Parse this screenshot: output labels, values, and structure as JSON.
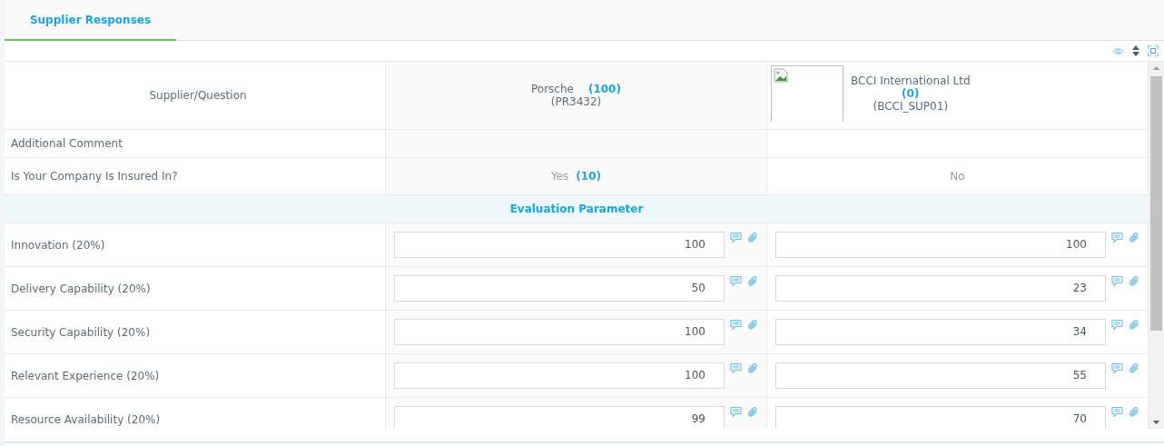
{
  "tabs": [
    {
      "label": "Supplier Responses",
      "selected": true
    }
  ],
  "table": {
    "header_label": "Supplier/Question",
    "suppliers": [
      {
        "name": "Porsche",
        "score": "(100)",
        "code": "(PR3432)",
        "has_logo": false
      },
      {
        "name": "BCCI International Ltd",
        "score": "(0)",
        "code": "(BCCI_SUP01)",
        "has_logo": true
      }
    ],
    "rows": [
      {
        "kind": "question",
        "label": "Additional Comment"
      },
      {
        "kind": "question",
        "label": "Is Your Company Is Insured In?",
        "answers": [
          {
            "text": "Yes",
            "score": "(10)"
          },
          {
            "text": "No"
          }
        ]
      },
      {
        "kind": "section",
        "label": "Evaluation Parameter"
      },
      {
        "kind": "score",
        "label": "Innovation (20%)",
        "values": [
          "100",
          "100"
        ]
      },
      {
        "kind": "score",
        "label": "Delivery Capability (20%)",
        "values": [
          "50",
          "23"
        ]
      },
      {
        "kind": "score",
        "label": "Security Capability (20%)",
        "values": [
          "100",
          "34"
        ]
      },
      {
        "kind": "score",
        "label": "Relevant Experience (20%)",
        "values": [
          "100",
          "55"
        ]
      },
      {
        "kind": "score",
        "label": "Resource Availability (20%)",
        "values": [
          "99",
          "70"
        ]
      }
    ]
  }
}
